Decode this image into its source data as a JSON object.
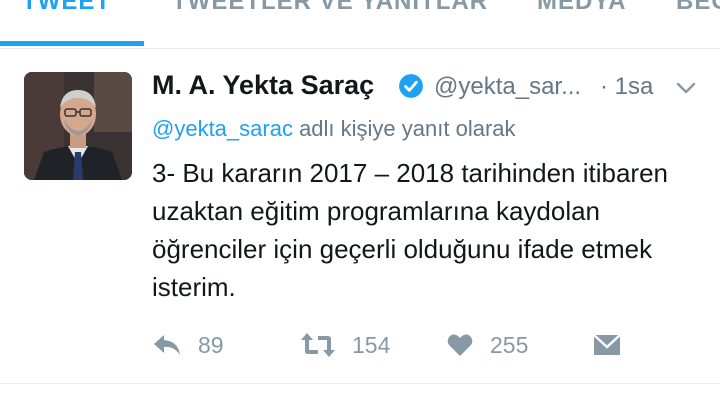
{
  "tabs": [
    {
      "label": "TWEET",
      "active": true
    },
    {
      "label": "TWEETLER VE YANITLAR",
      "active": false
    },
    {
      "label": "MEDYA",
      "active": false
    },
    {
      "label": "BEĞ",
      "active": false
    }
  ],
  "tweet": {
    "author_name": "M. A. Yekta Saraç",
    "verified": true,
    "handle": "@yekta_sar...",
    "time": "· 1sa",
    "reply_mention": "@yekta_sarac",
    "reply_suffix": " adlı kişiye yanıt olarak",
    "text": "3- Bu kararın 2017 – 2018 tarihinden itibaren uzaktan eğitim programlarına kaydolan öğrenciler için geçerli olduğunu ifade etmek isterim.",
    "replies": "89",
    "retweets": "154",
    "likes": "255"
  },
  "colors": {
    "accent": "#1da1f2",
    "muted": "#8899a6",
    "text": "#14171a",
    "secondary": "#657786"
  },
  "icons": {
    "verified": "verified-badge-icon",
    "caret": "chevron-down-icon",
    "reply": "reply-icon",
    "retweet": "retweet-icon",
    "like": "heart-icon",
    "dm": "envelope-icon"
  }
}
